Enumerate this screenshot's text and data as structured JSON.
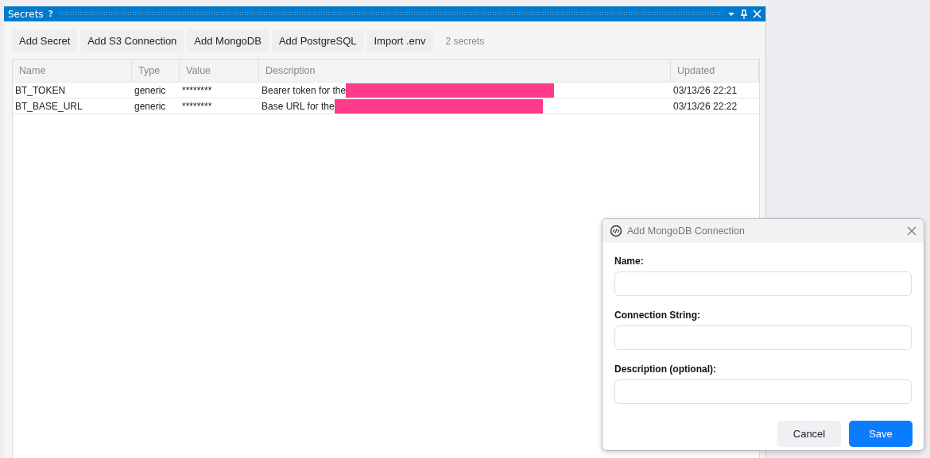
{
  "window": {
    "title": "Secrets",
    "help": "?"
  },
  "toolbar": {
    "buttons": [
      "Add Secret",
      "Add S3 Connection",
      "Add MongoDB",
      "Add PostgreSQL",
      "Import .env"
    ],
    "count": "2 secrets"
  },
  "table": {
    "columns": [
      "Name",
      "Type",
      "Value",
      "Description",
      "Updated"
    ],
    "rows": [
      {
        "name": "BT_TOKEN",
        "type": "generic",
        "value": "********",
        "description": "Bearer token for the",
        "redacted": true,
        "updated": "03/13/26 22:21"
      },
      {
        "name": "BT_BASE_URL",
        "type": "generic",
        "value": "********",
        "description": "Base URL for the",
        "redacted": true,
        "updated": "03/13/26 22:22"
      }
    ]
  },
  "dialog": {
    "title": "Add MongoDB Connection",
    "fields": [
      {
        "label": "Name:"
      },
      {
        "label": "Connection String:"
      },
      {
        "label": "Description (optional):"
      }
    ],
    "buttons": [
      {
        "label": "Cancel",
        "kind": "secondary"
      },
      {
        "label": "Save",
        "kind": "primary"
      }
    ]
  }
}
